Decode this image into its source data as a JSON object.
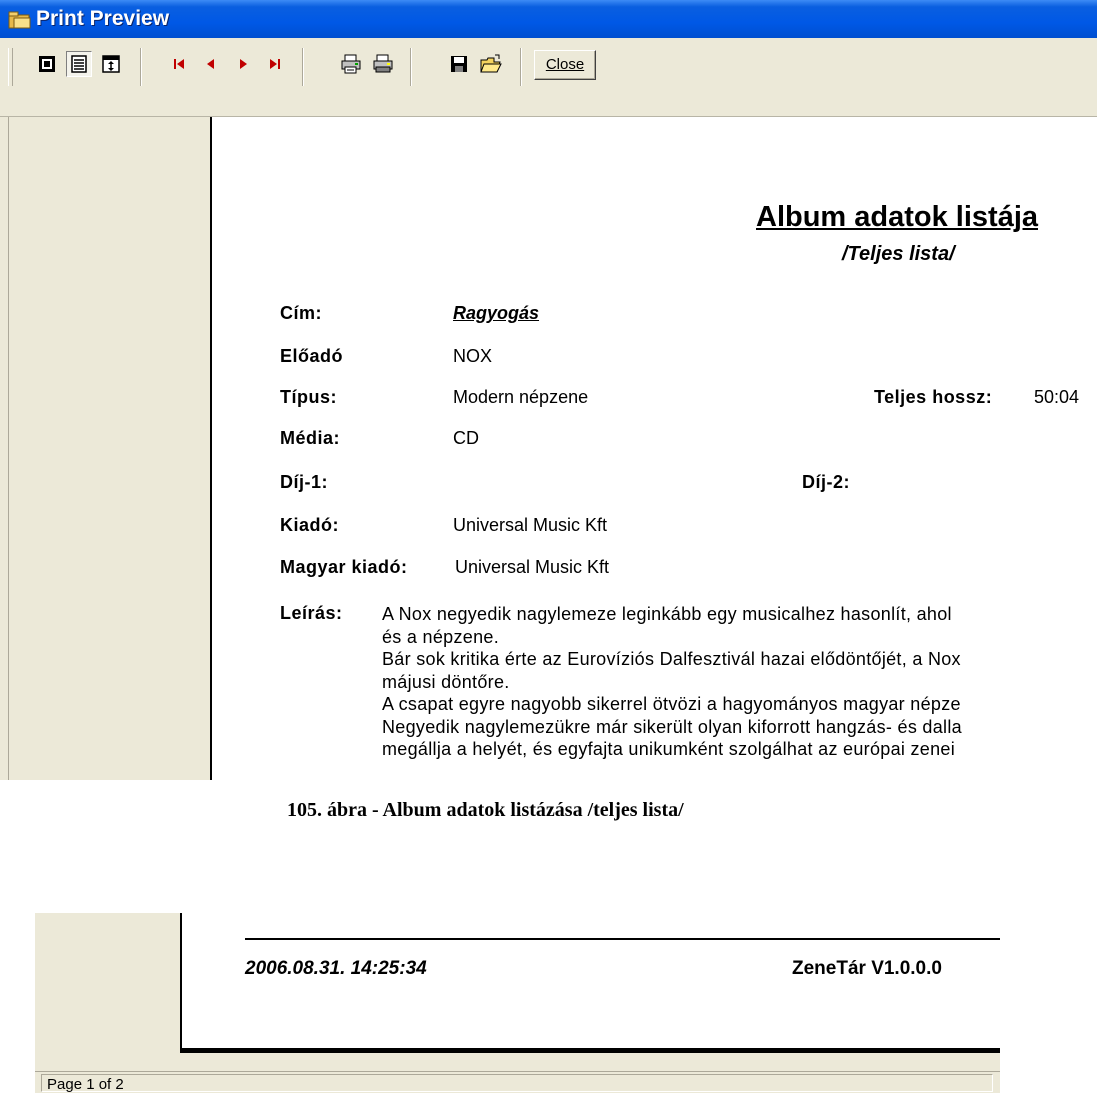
{
  "window": {
    "title": "Print Preview"
  },
  "toolbar": {
    "buttons": [
      {
        "name": "one-page-view",
        "icon": "one-page-icon"
      },
      {
        "name": "two-page-view",
        "icon": "multi-page-icon"
      },
      {
        "name": "zoom-view",
        "icon": "zoom-page-icon"
      },
      {
        "name": "first-page",
        "icon": "first-page-icon"
      },
      {
        "name": "previous-page",
        "icon": "previous-page-icon"
      },
      {
        "name": "next-page",
        "icon": "next-page-icon"
      },
      {
        "name": "last-page",
        "icon": "last-page-icon"
      },
      {
        "name": "print-setup",
        "icon": "printer-setup-icon"
      },
      {
        "name": "print",
        "icon": "printer-icon"
      },
      {
        "name": "save",
        "icon": "floppy-disk-icon"
      },
      {
        "name": "open",
        "icon": "open-folder-icon"
      }
    ],
    "close_label": "Close"
  },
  "report": {
    "title": "Album adatok listája",
    "subtitle": "/Teljes lista/",
    "fields": {
      "cim_label": "Cím:",
      "cim_value": "Ragyogás",
      "eloado_label": "Előadó",
      "eloado_value": "NOX",
      "tipus_label": "Típus:",
      "tipus_value": "Modern népzene",
      "teljes_hossz_label": "Teljes hossz:",
      "teljes_hossz_value": "50:04",
      "media_label": "Média:",
      "media_value": "CD",
      "dij1_label": "Díj-1:",
      "dij2_label": "Díj-2:",
      "kiado_label": "Kiadó:",
      "kiado_value": "Universal Music Kft",
      "magyar_kiado_label": "Magyar kiadó:",
      "magyar_kiado_value": "Universal Music Kft",
      "leiras_label": "Leírás:"
    },
    "description_lines": [
      "A Nox negyedik nagylemeze leginkább egy musicalhez hasonlít, ahol",
      "és a népzene.",
      "Bár sok kritika érte az Eurovíziós Dalfesztivál hazai elődöntőjét, a Nox",
      "májusi döntőre.",
      "A csapat egyre nagyobb sikerrel ötvözi a hagyományos magyar népze",
      "Negyedik nagylemezükre már sikerült olyan kiforrott hangzás- és dalla",
      "megállja a helyét, és egyfajta unikumként szolgálhat az európai zenei"
    ]
  },
  "caption": "105. ábra - Album adatok listázása /teljes lista/",
  "footer": {
    "datetime": "2006.08.31. 14:25:34",
    "version": "ZeneTár V1.0.0.0"
  },
  "status": {
    "page_indicator": "Page 1 of 2"
  },
  "colors": {
    "titlebar": "#0058e6",
    "chrome": "#ece9d8",
    "nav_arrow": "#c00000"
  }
}
